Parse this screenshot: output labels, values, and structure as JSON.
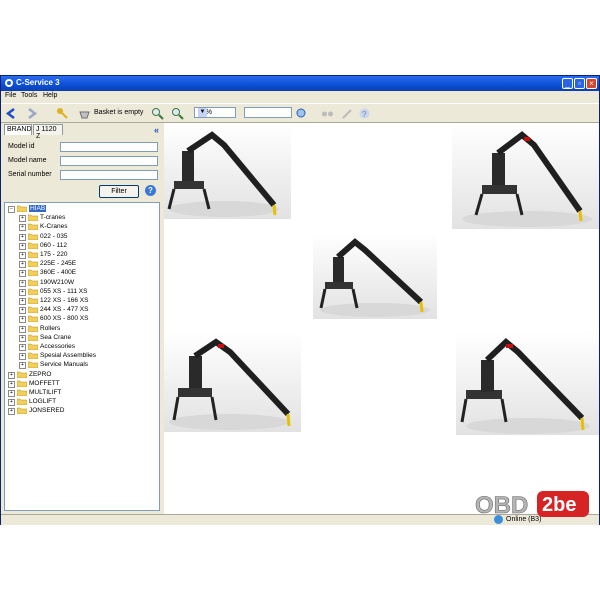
{
  "window": {
    "title": "C-Service 3"
  },
  "menu": [
    "File",
    "Tools",
    "Help"
  ],
  "toolbar": {
    "basket_label": "Basket is empty",
    "zoom_value": "40%",
    "search_value": ""
  },
  "left_panel": {
    "tabs": [
      "BRAND",
      "J 1120 Z"
    ],
    "fields": [
      {
        "label": "Model id",
        "value": ""
      },
      {
        "label": "Model name",
        "value": ""
      },
      {
        "label": "Serial number",
        "value": ""
      }
    ],
    "filter_button": "Filter",
    "tree": {
      "root_selected": "HIAB",
      "hiab_children": [
        "T-cranes",
        "K-Cranes",
        "022 - 035",
        "060 - 112",
        "175 - 220",
        "225E - 245E",
        "360E - 400E",
        "190W210W",
        "055 XS - 111 XS",
        "122 XS - 166 XS",
        "244 XS - 477 XS",
        "600 XS - 800 XS",
        "Rollers",
        "Sea Crane",
        "Accessories",
        "Spesial Assemblies",
        "Service Manuals"
      ],
      "other_brands": [
        "ZEPRO",
        "MOFFETT",
        "MULTILIFT",
        "LOGLIFT",
        "JONSERED"
      ]
    }
  },
  "content": {
    "cranes": [
      "crane-1",
      "crane-2",
      "crane-3",
      "crane-4",
      "crane-5"
    ]
  },
  "status": {
    "connection": "Online (B3)"
  },
  "watermark": {
    "text_obd": "OBD",
    "text_2be": "2be"
  },
  "colors": {
    "titlebar": "#0b4fd6",
    "selection": "#316ac5",
    "folder": "#f3cf5a",
    "watermark_red": "#d62424"
  }
}
